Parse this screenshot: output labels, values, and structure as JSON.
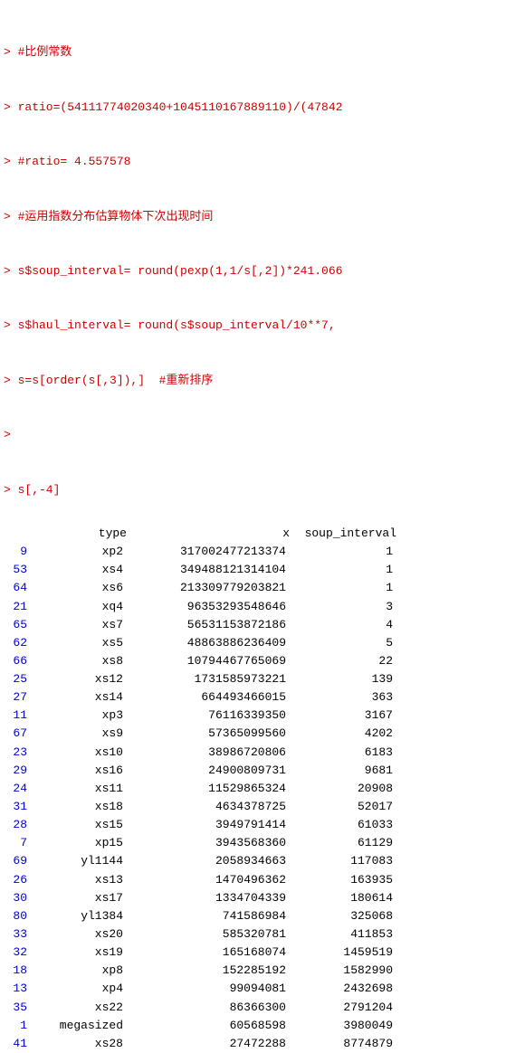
{
  "console": {
    "lines": [
      {
        "type": "red",
        "text": "> #比例常数"
      },
      {
        "type": "red",
        "text": "> ratio=(54111774020340+1045110167889110)/(47842"
      },
      {
        "type": "red",
        "text": "> #ratio= 4.557578"
      },
      {
        "type": "red",
        "text": "> #运用指数分布估算物体下次出现时间"
      },
      {
        "type": "red",
        "text": "> s$soup_interval= round(pexp(1,1/s[,2])*241.066"
      },
      {
        "type": "red",
        "text": "> s$haul_interval= round(s$soup_interval/10**7,"
      },
      {
        "type": "red",
        "text": "> s=s[order(s[,3]),]  #重新排序"
      },
      {
        "type": "red",
        "text": ">"
      },
      {
        "type": "red",
        "text": "> s[,-4]"
      }
    ]
  },
  "table": {
    "headers": {
      "rownum": "",
      "type": "type",
      "x": "x",
      "soup_interval": "soup_interval"
    },
    "rows": [
      {
        "rownum": "9",
        "type": "xp2",
        "x": "317002477213374",
        "soup_interval": "1"
      },
      {
        "rownum": "53",
        "type": "xs4",
        "x": "349488121314104",
        "soup_interval": "1"
      },
      {
        "rownum": "64",
        "type": "xs6",
        "x": "213309779203821",
        "soup_interval": "1"
      },
      {
        "rownum": "21",
        "type": "xq4",
        "x": "96353293548646",
        "soup_interval": "3"
      },
      {
        "rownum": "65",
        "type": "xs7",
        "x": "56531153872186",
        "soup_interval": "4"
      },
      {
        "rownum": "62",
        "type": "xs5",
        "x": "48863886236409",
        "soup_interval": "5"
      },
      {
        "rownum": "66",
        "type": "xs8",
        "x": "10794467765069",
        "soup_interval": "22"
      },
      {
        "rownum": "25",
        "type": "xs12",
        "x": "1731585973221",
        "soup_interval": "139"
      },
      {
        "rownum": "27",
        "type": "xs14",
        "x": "664493466015",
        "soup_interval": "363"
      },
      {
        "rownum": "11",
        "type": "xp3",
        "x": "76116339350",
        "soup_interval": "3167"
      },
      {
        "rownum": "67",
        "type": "xs9",
        "x": "57365099560",
        "soup_interval": "4202"
      },
      {
        "rownum": "23",
        "type": "xs10",
        "x": "38986720806",
        "soup_interval": "6183"
      },
      {
        "rownum": "29",
        "type": "xs16",
        "x": "24900809731",
        "soup_interval": "9681"
      },
      {
        "rownum": "24",
        "type": "xs11",
        "x": "11529865324",
        "soup_interval": "20908"
      },
      {
        "rownum": "31",
        "type": "xs18",
        "x": "4634378725",
        "soup_interval": "52017"
      },
      {
        "rownum": "28",
        "type": "xs15",
        "x": "3949791414",
        "soup_interval": "61033"
      },
      {
        "rownum": "7",
        "type": "xp15",
        "x": "3943568360",
        "soup_interval": "61129"
      },
      {
        "rownum": "69",
        "type": "yl1144",
        "x": "2058934663",
        "soup_interval": "117083"
      },
      {
        "rownum": "26",
        "type": "xs13",
        "x": "1470496362",
        "soup_interval": "163935"
      },
      {
        "rownum": "30",
        "type": "xs17",
        "x": "1334704339",
        "soup_interval": "180614"
      },
      {
        "rownum": "80",
        "type": "yl1384",
        "x": "741586984",
        "soup_interval": "325068"
      },
      {
        "rownum": "33",
        "type": "xs20",
        "x": "585320781",
        "soup_interval": "411853"
      },
      {
        "rownum": "32",
        "type": "xs19",
        "x": "165168074",
        "soup_interval": "1459519"
      },
      {
        "rownum": "18",
        "type": "xp8",
        "x": "152285192",
        "soup_interval": "1582990"
      },
      {
        "rownum": "13",
        "type": "xp4",
        "x": "99094081",
        "soup_interval": "2432698"
      },
      {
        "rownum": "35",
        "type": "xs22",
        "x": "86366300",
        "soup_interval": "2791204"
      },
      {
        "rownum": "1",
        "type": "megasized",
        "x": "60568598",
        "soup_interval": "3980049"
      },
      {
        "rownum": "41",
        "type": "xs28",
        "x": "27472288",
        "soup_interval": "8774879"
      }
    ]
  }
}
